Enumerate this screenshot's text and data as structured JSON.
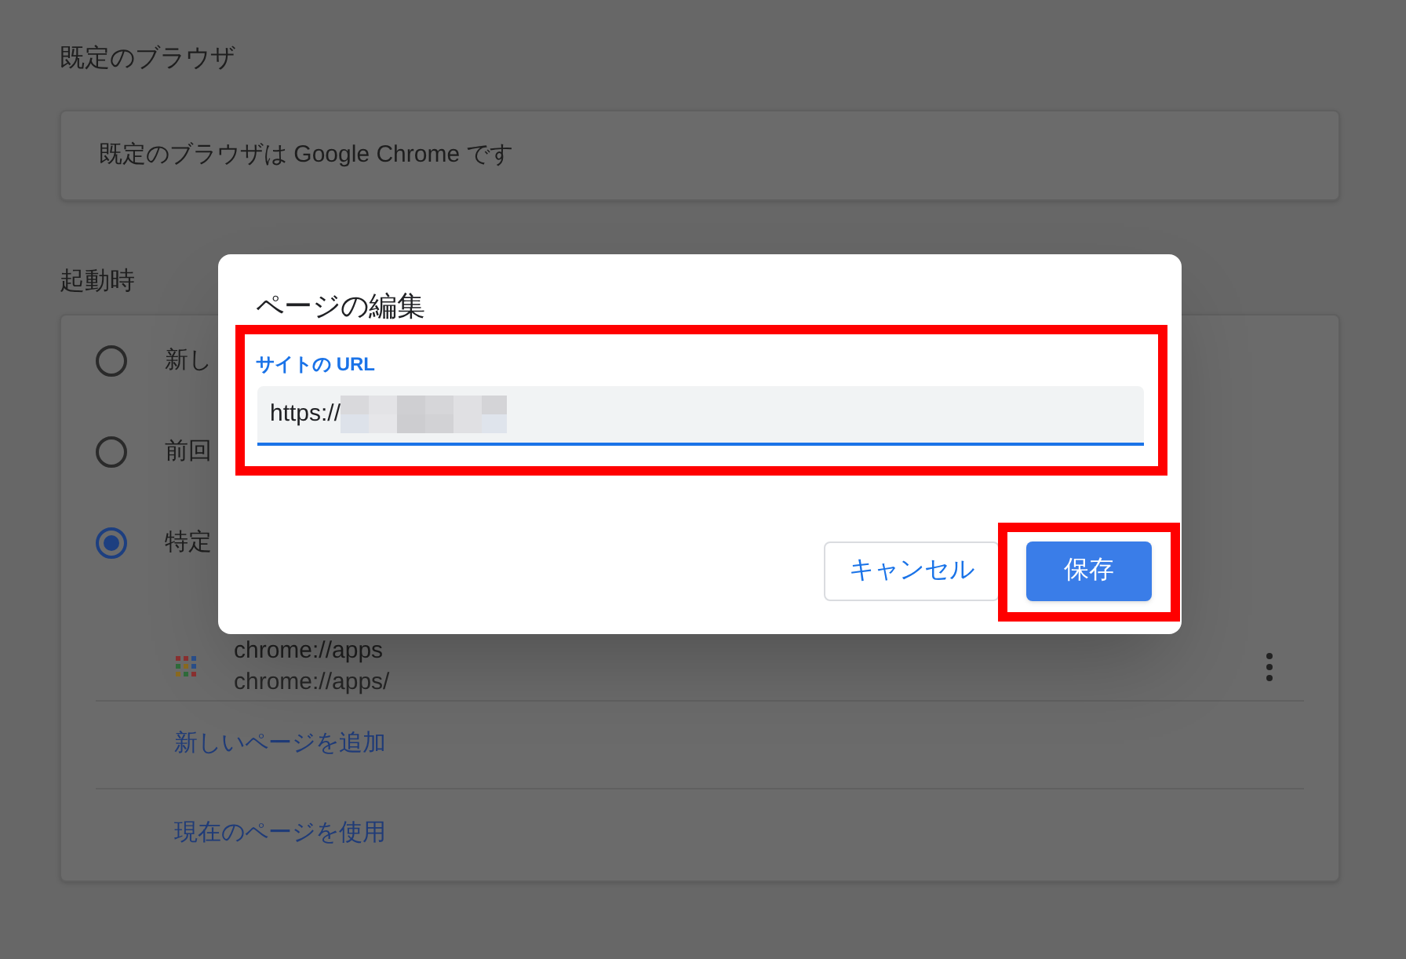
{
  "settings": {
    "default_browser": {
      "heading": "既定のブラウザ",
      "status": "既定のブラウザは Google Chrome です"
    },
    "on_startup": {
      "heading": "起動時",
      "options": [
        {
          "label": "新し",
          "selected": false
        },
        {
          "label": "前回",
          "selected": false
        },
        {
          "label": "特定",
          "selected": true
        }
      ],
      "pages": [
        {
          "title": "chrome://apps",
          "url": "chrome://apps/"
        }
      ],
      "links": [
        "新しいページを追加",
        "現在のページを使用"
      ]
    }
  },
  "dialog": {
    "title": "ページの編集",
    "field": {
      "label": "サイトの URL",
      "value": "https://",
      "highlighted": true
    },
    "buttons": [
      {
        "label": "キャンセル",
        "kind": "secondary",
        "highlighted": false
      },
      {
        "label": "保存",
        "kind": "primary",
        "highlighted": true
      }
    ]
  }
}
